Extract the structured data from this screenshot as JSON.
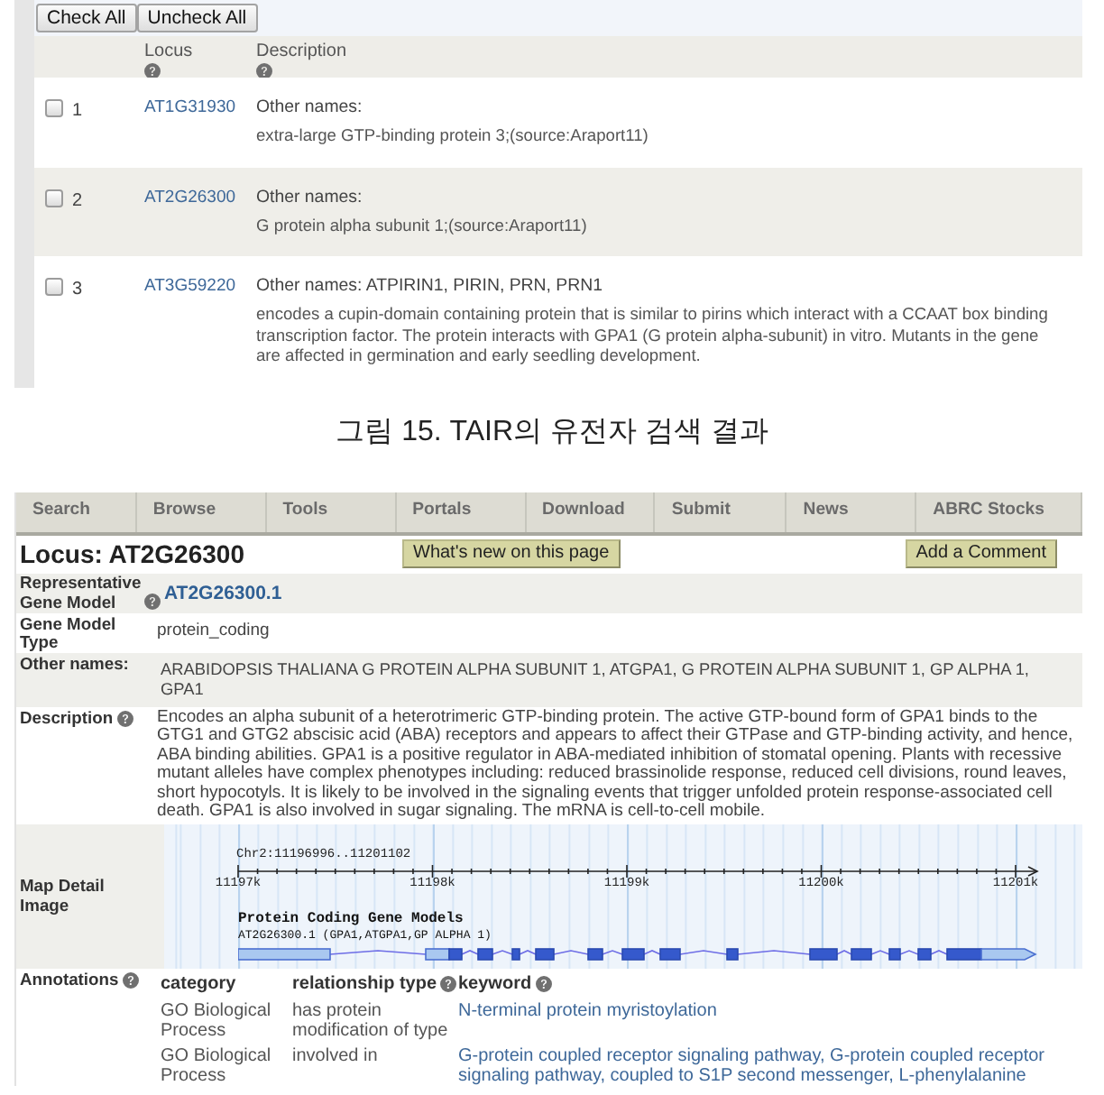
{
  "results": {
    "buttons": [
      "Check All",
      "Uncheck All"
    ],
    "columns": [
      {
        "label": "Locus",
        "help": true
      },
      {
        "label": "Description",
        "help": true
      }
    ],
    "rows": [
      {
        "number": "1",
        "checked": false,
        "locus": "AT1G31930",
        "other_names": "Other names:",
        "description": "extra-large GTP-binding protein 3;(source:Araport11)"
      },
      {
        "number": "2",
        "checked": false,
        "locus": "AT2G26300",
        "other_names": "Other names:",
        "description": "G protein alpha subunit 1;(source:Araport11)"
      },
      {
        "number": "3",
        "checked": false,
        "locus": "AT3G59220",
        "other_names": "Other names: ATPIRIN1, PIRIN, PRN, PRN1",
        "description": "encodes a cupin-domain containing protein that is similar to pirins which interact with a CCAAT box binding transcription factor. The protein interacts with GPA1 (G protein alpha-subunit) in vitro. Mutants in the gene are affected in germination and early seedling development."
      }
    ]
  },
  "caption": "그림 15. TAIR의 유전자 검색 결과",
  "locus_page": {
    "nav": [
      "Search",
      "Browse",
      "Tools",
      "Portals",
      "Download",
      "Submit",
      "News",
      "ABRC Stocks"
    ],
    "title": "Locus: AT2G26300",
    "buttons": [
      "What's new on this page",
      "Add a Comment"
    ],
    "fields": [
      {
        "kind": "link",
        "label": "Representative Gene Model",
        "help": true,
        "value": "AT2G26300.1"
      },
      {
        "kind": "text",
        "label": "Gene Model Type",
        "help": false,
        "value": "protein_coding"
      },
      {
        "kind": "names",
        "label": "Other names:",
        "help": false,
        "value": "ARABIDOPSIS THALIANA G PROTEIN ALPHA SUBUNIT 1, ATGPA1, G PROTEIN ALPHA SUBUNIT 1, GP ALPHA 1, GPA1"
      },
      {
        "kind": "text",
        "label": "Description",
        "help": true,
        "value": "Encodes an alpha subunit of a heterotrimeric GTP-binding protein. The active GTP-bound form of GPA1 binds to the GTG1 and GTG2 abscisic acid (ABA) receptors and appears to affect their GTPase and GTP-binding activity, and hence, ABA binding abilities. GPA1 is a positive regulator in ABA-mediated inhibition of stomatal opening. Plants with recessive mutant alleles have complex phenotypes including: reduced brassinolide response, reduced cell divisions, round leaves, short hypocotyls. It is likely to be involved in the signaling events that trigger unfolded protein response-associated cell death. GPA1 is also involved in sugar signaling. The mRNA is cell-to-cell mobile."
      },
      {
        "kind": "map",
        "label": "Map Detail Image",
        "help": false,
        "map": {
          "region": "Chr2:11196996..11201102",
          "ticks": [
            "11197k",
            "11198k",
            "11199k",
            "11200k",
            "11201k"
          ],
          "track_title": "Protein Coding Gene Models",
          "gene_label": "AT2G26300.1 (GPA1,ATGPA1,GP ALPHA 1)"
        }
      },
      {
        "kind": "annotations",
        "label": "Annotations",
        "help": true,
        "annotations": {
          "columns": [
            {
              "label": "category",
              "help": false
            },
            {
              "label": "relationship type",
              "help": true
            },
            {
              "label": "keyword",
              "help": true
            }
          ],
          "rows": [
            {
              "category": "GO Biological Process",
              "relationship": "has protein modification of type",
              "keyword": "N-terminal protein myristoylation"
            },
            {
              "category": "GO Biological Process",
              "relationship": "involved in",
              "keyword": "G-protein coupled receptor signaling pathway, G-protein coupled receptor signaling pathway, coupled to S1P second messenger, L-phenylalanine"
            }
          ]
        }
      }
    ]
  }
}
